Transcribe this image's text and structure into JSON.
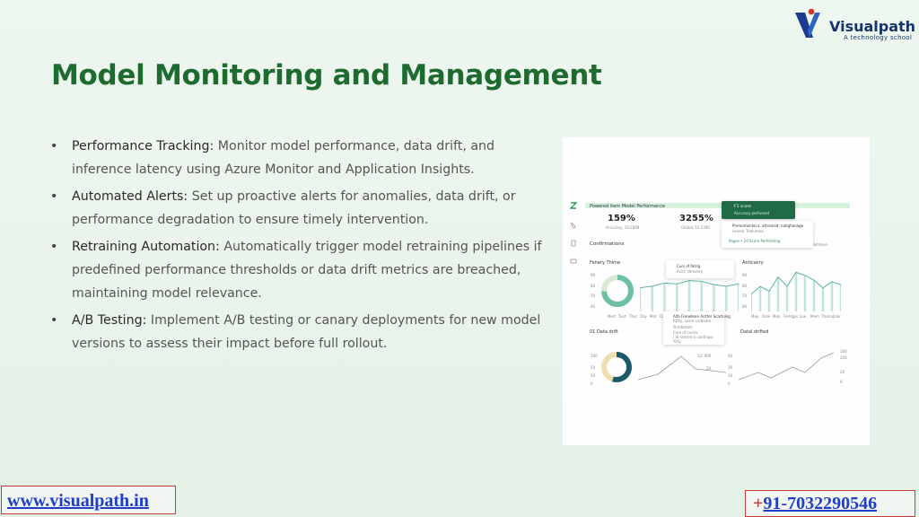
{
  "title": "Model Monitoring and Management",
  "logo": {
    "name": "Visualpath",
    "tagline": "A technology school"
  },
  "bullets": [
    {
      "label": "Performance Tracking:",
      "text": " Monitor model performance, data drift, and inference latency using Azure Monitor and Application Insights."
    },
    {
      "label": "Automated Alerts:",
      "text": " Set up proactive alerts for anomalies, data drift, or performance degradation to ensure timely intervention."
    },
    {
      "label": "Retraining Automation:",
      "text": " Automatically trigger model retraining pipelines if predefined performance thresholds or data drift metrics are breached, maintaining model relevance."
    },
    {
      "label": "A/B Testing:",
      "text": " Implement A/B testing or canary deployments for new model versions to assess their impact before full rollout."
    }
  ],
  "bullet_glyph": "•",
  "dashboard": {
    "header": "Powered item Model Performance",
    "stat1": {
      "value": "159%",
      "sub": "Accuracy, 10.2848"
    },
    "stat2": {
      "value": "3255%",
      "sub": "Global, 10.1300"
    },
    "section": "Confirmations",
    "section_actions": "Retrieve",
    "card1": {
      "title": "Fenery Thime",
      "ticks": [
        "90",
        "80",
        "70",
        "60",
        "40"
      ],
      "xlabels": [
        "Mert",
        "Tuot",
        "Thur",
        "Day",
        "Mot",
        "Dat"
      ]
    },
    "card2": {
      "title": "Anticavry",
      "ticks": [
        "90",
        "80",
        "70",
        "60",
        "40"
      ],
      "xlabels": [
        "Mep",
        "Dme",
        "Mon",
        "Femlger",
        "Lue",
        "Mem",
        "Ttuma",
        "Jalor"
      ]
    },
    "card3": {
      "title": "01 Data drift",
      "ticks": [
        "100",
        "50",
        "20",
        "0"
      ],
      "labels": [
        "12. 900",
        "20"
      ]
    },
    "card4": {
      "title": "Datal drifted",
      "ticks": [
        "40",
        "20",
        "10",
        "0"
      ],
      "labels": [
        "100",
        "200",
        "20",
        "0"
      ]
    },
    "popup_top": {
      "title": "F1 score",
      "sub": "Accuracy perfumed"
    },
    "popup_right": {
      "title": "Premomental a. attrained: natighanage",
      "sub": "Lenear Tridiumed",
      "footer": "Pages • 10 Score Performing"
    },
    "popup_mid": {
      "title": "Curs of fatrig",
      "sub": "Asirt, shrovery"
    },
    "popup_bottom": {
      "title": "Alfa Frerwhere Acitter Scartuing",
      "sub": "Rtfily, sosre celitaitro",
      "line2": "Pint/botart",
      "line3": "Cam of Luctiv",
      "line4": "I I4 ranorel a contingo",
      "line5": "Yitfy"
    }
  },
  "chart_data": [
    {
      "type": "line",
      "title": "Fenery Thime",
      "x": [
        "Mert",
        "Tuot",
        "Thur",
        "Day",
        "Mot",
        "Dat"
      ],
      "series": [
        {
          "values": [
            70,
            72,
            76,
            75,
            79,
            78,
            74,
            72,
            75
          ]
        }
      ]
    },
    {
      "type": "line",
      "title": "Anticavry",
      "series": [
        {
          "values": [
            62,
            72,
            66,
            84,
            72,
            90,
            86,
            80,
            70,
            78,
            74
          ]
        }
      ]
    }
  ],
  "footer": {
    "website": "www.visualpath.in",
    "phone_plus": "+",
    "phone": "91-7032290546"
  },
  "colors": {
    "title": "#1d6b2f",
    "accent": "#4dbb7a",
    "chart_line": "#5bb895",
    "link": "#1f3fc8",
    "border": "#c63a3a"
  }
}
